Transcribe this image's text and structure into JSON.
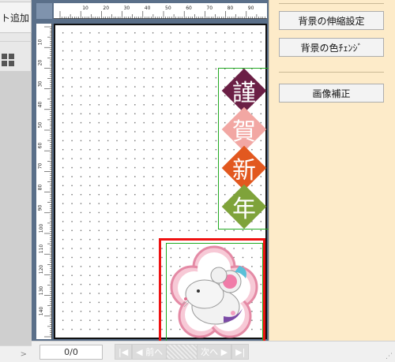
{
  "left_panel": {
    "add_button_label": "ト追加",
    "icon": "grid-icon",
    "collapse_arrow": ">"
  },
  "ruler": {
    "top_ticks": [
      "10",
      "20",
      "30",
      "40",
      "50",
      "60",
      "70",
      "80",
      "90"
    ],
    "left_ticks": [
      "10",
      "20",
      "30",
      "40",
      "50",
      "60",
      "70",
      "80",
      "90",
      "100",
      "110",
      "120",
      "130",
      "140"
    ]
  },
  "canvas": {
    "kanji": [
      {
        "char": "謹",
        "color": "#6b1f45"
      },
      {
        "char": "賀",
        "color": "#f2a7a3"
      },
      {
        "char": "新",
        "color": "#e2581f"
      },
      {
        "char": "年",
        "color": "#7fa33a"
      }
    ],
    "text_frame_color": "#22aa22",
    "image_frame_color": "#ee1111",
    "illustration": "mouse-new-year-illustration"
  },
  "right_panel": {
    "stretch_bg_label": "背景の伸縮設定",
    "color_change_label": "背景の色ﾁｪﾝｼﾞ",
    "image_correction_label": "画像補正"
  },
  "status_bar": {
    "page_count": "0/0",
    "prev_label": "前へ",
    "next_label": "次へ"
  },
  "colors": {
    "right_panel_bg": "#fdebc9",
    "canvas_bg": "#5a6f89"
  }
}
